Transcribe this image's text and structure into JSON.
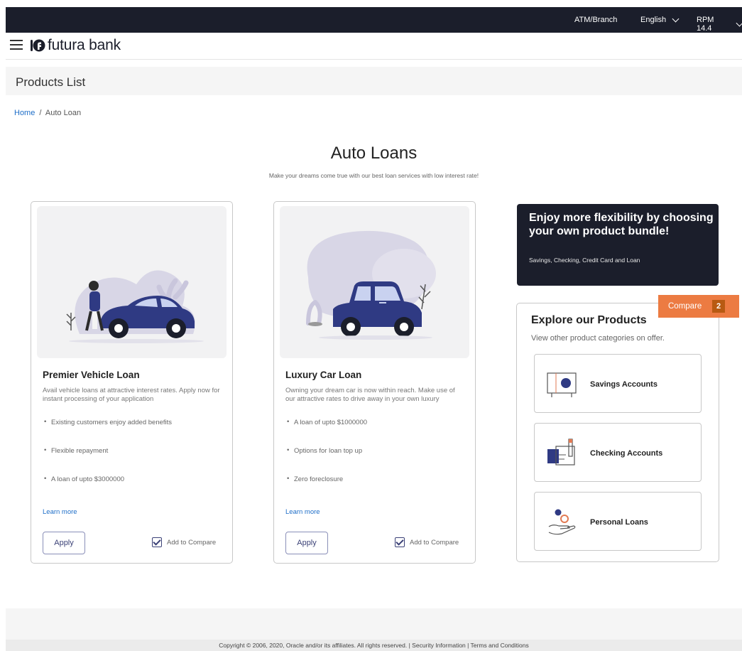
{
  "topbar": {
    "atm_branch": "ATM/Branch",
    "language": "English",
    "version": "RPM 14.4"
  },
  "header": {
    "brand": "futura bank"
  },
  "page": {
    "title": "Products List"
  },
  "breadcrumb": {
    "home": "Home",
    "separator": "/",
    "current": "Auto Loan"
  },
  "main": {
    "title": "Auto Loans",
    "subtitle": "Make your dreams come true with our best loan services with low interest rate!"
  },
  "cards": [
    {
      "title": "Premier Vehicle Loan",
      "description": "Avail vehicle loans at attractive interest rates. Apply now for instant processing of your application",
      "features": [
        "Existing customers enjoy added benefits",
        "Flexible repayment",
        "A loan of upto $3000000"
      ],
      "learn_more": "Learn more",
      "apply": "Apply",
      "compare_label": "Add to Compare",
      "compare_checked": true
    },
    {
      "title": "Luxury Car Loan",
      "description": "Owning your dream car is now within reach. Make use of our attractive rates to drive away in your own luxury",
      "features": [
        "A loan of upto $1000000",
        "Options for loan top up",
        "Zero foreclosure"
      ],
      "learn_more": "Learn more",
      "apply": "Apply",
      "compare_label": "Add to Compare",
      "compare_checked": true
    }
  ],
  "promo": {
    "title": "Enjoy more flexibility by choosing your own product bundle!",
    "subtitle": "Savings, Checking, Credit Card and Loan"
  },
  "explore": {
    "title": "Explore our Products",
    "subtitle": "View other product categories on offer.",
    "products": [
      {
        "label": "Savings Accounts",
        "icon": "safe-icon"
      },
      {
        "label": "Checking Accounts",
        "icon": "checkbook-icon"
      },
      {
        "label": "Personal Loans",
        "icon": "hand-coins-icon"
      }
    ]
  },
  "compare": {
    "label": "Compare",
    "count": "2"
  },
  "footer": {
    "text": "Copyright © 2006, 2020, Oracle and/or its affiliates. All rights reserved. | Security Information | Terms and Conditions"
  },
  "colors": {
    "dark_navy": "#1b1e2b",
    "accent_blue": "#3b4177",
    "link_blue": "#1e6ec8",
    "compare_orange": "#ec7b42",
    "compare_count": "#b85a12"
  }
}
